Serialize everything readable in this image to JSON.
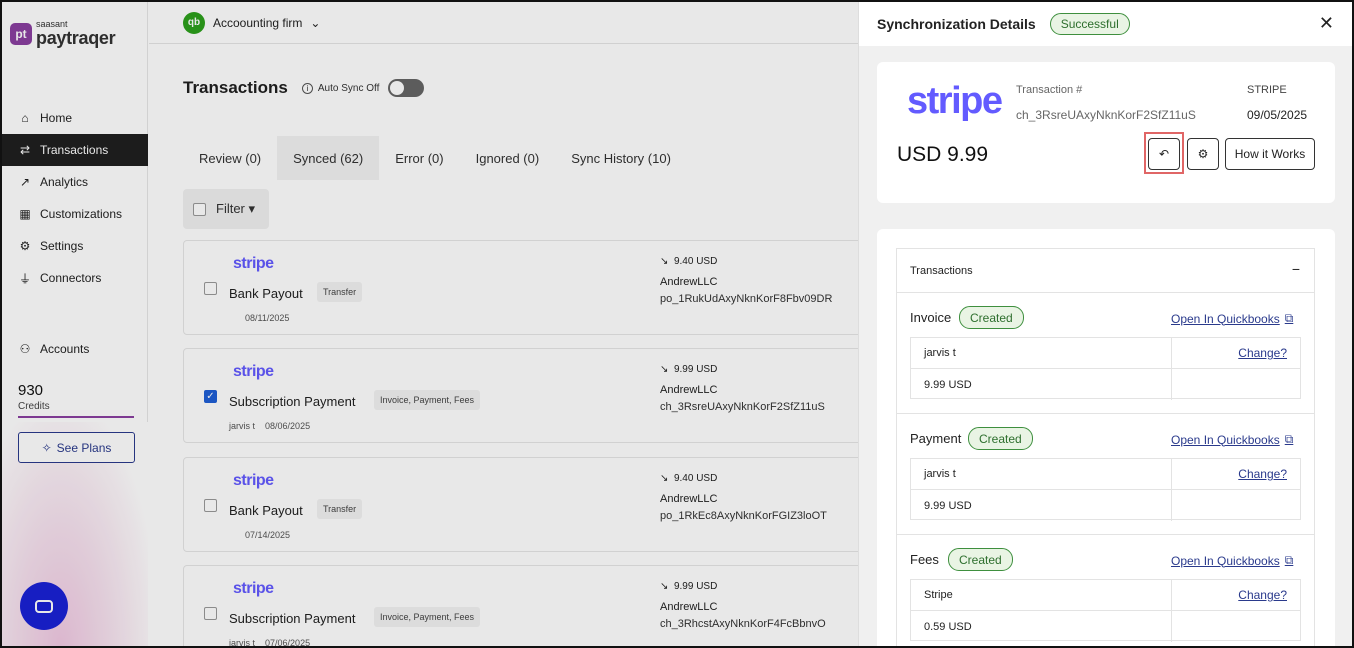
{
  "brand": {
    "mark": "pt",
    "small": "saasant",
    "name": "paytraqer"
  },
  "sidebar": {
    "items": [
      {
        "label": "Home",
        "icon": "home-icon"
      },
      {
        "label": "Transactions",
        "icon": "swap-icon",
        "active": true
      },
      {
        "label": "Analytics",
        "icon": "chart-line-icon"
      },
      {
        "label": "Customizations",
        "icon": "grid-icon"
      },
      {
        "label": "Settings",
        "icon": "gear-icon"
      },
      {
        "label": "Connectors",
        "icon": "plug-icon"
      }
    ],
    "accounts_label": "Accounts",
    "credits_value": "930",
    "credits_label": "Credits",
    "see_plans": "See Plans"
  },
  "topbar": {
    "company": "Accoounting firm"
  },
  "page": {
    "title": "Transactions",
    "auto_sync": "Auto Sync Off",
    "tabs": [
      "Review (0)",
      "Synced (62)",
      "Error (0)",
      "Ignored (0)",
      "Sync History (10)"
    ],
    "filter": "Filter"
  },
  "transactions": [
    {
      "brand": "stripe",
      "title": "Bank Payout",
      "tag": "Transfer",
      "date": "08/11/2025",
      "user": "",
      "amount": "9.40 USD",
      "customer": "AndrewLLC",
      "ref": "po_1RukUdAxyNknKorF8Fbv09DR",
      "checked": false
    },
    {
      "brand": "stripe",
      "title": "Subscription Payment",
      "tag": "Invoice, Payment, Fees",
      "date": "08/06/2025",
      "user": "jarvis t",
      "amount": "9.99 USD",
      "customer": "AndrewLLC",
      "ref": "ch_3RsreUAxyNknKorF2SfZ11uS",
      "checked": true
    },
    {
      "brand": "stripe",
      "title": "Bank Payout",
      "tag": "Transfer",
      "date": "07/14/2025",
      "user": "",
      "amount": "9.40 USD",
      "customer": "AndrewLLC",
      "ref": "po_1RkEc8AxyNknKorFGIZ3loOT",
      "checked": false
    },
    {
      "brand": "stripe",
      "title": "Subscription Payment",
      "tag": "Invoice, Payment, Fees",
      "date": "07/06/2025",
      "user": "jarvis t",
      "amount": "9.99 USD",
      "customer": "AndrewLLC",
      "ref": "ch_3RhcstAxyNknKorF4FcBbnvO",
      "checked": false
    }
  ],
  "panel": {
    "title": "Synchronization Details",
    "status": "Successful",
    "brand": "stripe",
    "amount": "USD 9.99",
    "tx_label": "Transaction #",
    "tx_id": "ch_3RsreUAxyNknKorF2SfZ11uS",
    "source": "STRIPE",
    "date": "09/05/2025",
    "how_it_works": "How it Works",
    "section_title": "Transactions",
    "link_text": "Open In Quickbooks",
    "change_text": "Change?",
    "sections": [
      {
        "title": "Invoice",
        "status": "Created",
        "name": "jarvis t",
        "amount": "9.99 USD"
      },
      {
        "title": "Payment",
        "status": "Created",
        "name": "jarvis t",
        "amount": "9.99 USD"
      },
      {
        "title": "Fees",
        "status": "Created",
        "name": "Stripe",
        "amount": "0.59 USD"
      }
    ]
  },
  "colors": {
    "accent": "#635bff",
    "success": "#2e6f2e",
    "link": "#2a3a8c",
    "brand": "#8a3fa0"
  }
}
